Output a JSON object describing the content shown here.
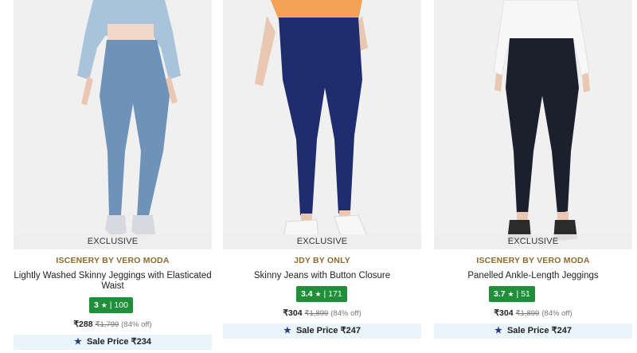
{
  "products": [
    {
      "exclusive_label": "EXCLUSIVE",
      "brand": "ISCENERY BY VERO MODA",
      "name": "Lightly Washed Skinny Jeggings with Elasticated Waist",
      "rating": "3",
      "star": "★",
      "rating_sep": "|",
      "reviews": "100",
      "price": "₹288",
      "mrp": "₹1,799",
      "discount": "(84% off)",
      "sale_icon": "★",
      "sale_label": "Sale Price ₹234",
      "image": {
        "garment": "light blue skinny jeggings",
        "top": "denim jacket",
        "shoes": "silver heels"
      }
    },
    {
      "exclusive_label": "EXCLUSIVE",
      "brand": "JDY BY ONLY",
      "name": "Skinny Jeans with Button Closure",
      "rating": "3.4",
      "star": "★",
      "rating_sep": "|",
      "reviews": "171",
      "price": "₹304",
      "mrp": "₹1,899",
      "discount": "(84% off)",
      "sale_icon": "★",
      "sale_label": "Sale Price ₹247",
      "image": {
        "garment": "dark navy skinny jeans",
        "top": "orange top",
        "shoes": "white sneakers"
      }
    },
    {
      "exclusive_label": "EXCLUSIVE",
      "brand": "ISCENERY BY VERO MODA",
      "name": "Panelled Ankle-Length Jeggings",
      "rating": "3.7",
      "star": "★",
      "rating_sep": "|",
      "reviews": "51",
      "price": "₹304",
      "mrp": "₹1,899",
      "discount": "(84% off)",
      "sale_icon": "★",
      "sale_label": "Sale Price ₹247",
      "image": {
        "garment": "black ankle-length jeggings",
        "top": "white shirt",
        "shoes": "black sandals"
      }
    }
  ],
  "colors": {
    "brand_text": "#8a6a2e",
    "rating_badge": "#1f8f3a",
    "sale_bg": "#e9f4fb",
    "sale_icon": "#2d3a7a"
  }
}
